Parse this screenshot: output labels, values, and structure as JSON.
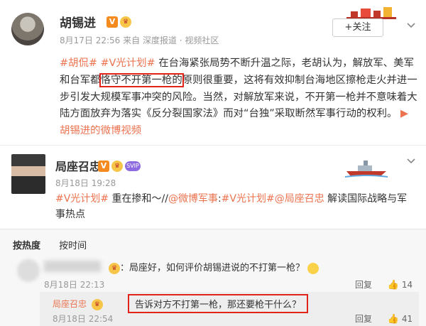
{
  "post": {
    "author": "胡锡进",
    "v_badge": "V",
    "vip_badge": "♛",
    "time": "8月17日 22:56",
    "source": "来自 深度报道 · 视频社区",
    "follow_label": "+关注",
    "tags": [
      "#胡侃#",
      "#V光计划#"
    ],
    "text_1": " 在台海紧张局势不断升温之际，老胡认为，解放军、美军和台军都",
    "text_highlight": "恪守不开第一枪的",
    "text_2": "原则很重要，这将有效抑制台海地区擦枪走火并进一步引发大规模军事冲突的风险。当然，对解放军来说，不开第一枪并不意味着大陆方面放弃为落实《反分裂国家法》而对“台独”采取断然军事行动的权利。",
    "video_link": "胡锡进的微博视频"
  },
  "repost": {
    "author": "局座召忠",
    "v_badge": "V",
    "vip_badge": "♛",
    "svip_badge": "SVIP",
    "time": "8月18日 19:28",
    "tag": "#V光计划#",
    "text_1": " 重在掺和～//",
    "mention": "@微博军事",
    "text_2": ":",
    "tag2": "#V光计划#",
    "mention2": "@局座召忠",
    "text_3": " 解读国际战略与军事热点"
  },
  "comments": {
    "sort_hot": "按热度",
    "sort_time": "按时间",
    "first": {
      "text": "：局座好，如何评价胡锡进说的不打第一枪？",
      "time": "8月18日 22:13",
      "reply_label": "回复",
      "likes": "14"
    },
    "reply": {
      "author": "局座召忠",
      "text": "告诉对方不打第一枪，那还要枪干什么？",
      "time": "8月18日 22:54",
      "reply_label": "回复",
      "likes": "41"
    }
  },
  "colors": {
    "accent": "#eb7350",
    "highlight": "#e2231a"
  }
}
